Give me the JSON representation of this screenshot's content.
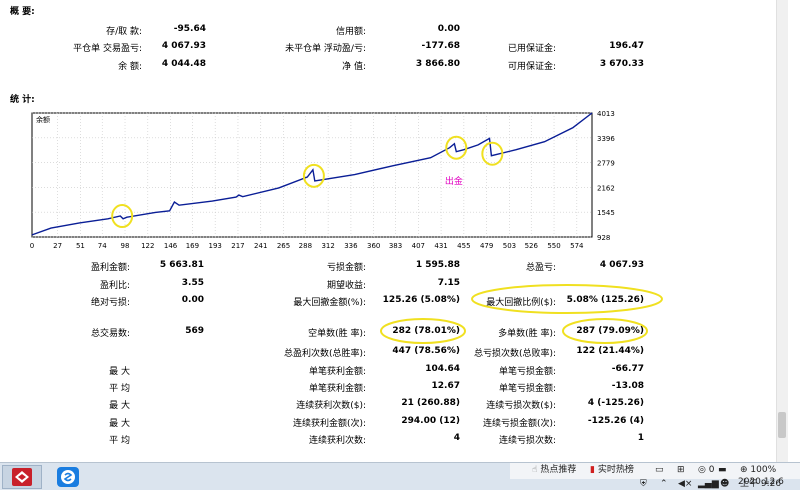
{
  "summary": {
    "title": "概 要:",
    "rows": [
      [
        {
          "label": "存/取 款:",
          "value": "-95.64"
        },
        {
          "label": "信用额:",
          "value": "0.00"
        },
        {
          "label": "",
          "value": ""
        }
      ],
      [
        {
          "label": "平仓单 交易盈亏:",
          "value": "4 067.93"
        },
        {
          "label": "未平仓单 浮动盈/亏:",
          "value": "-177.68"
        },
        {
          "label": "已用保证金:",
          "value": "196.47"
        }
      ],
      [
        {
          "label": "余 额:",
          "value": "4 044.48"
        },
        {
          "label": "净 值:",
          "value": "3 866.80"
        },
        {
          "label": "可用保证金:",
          "value": "3 670.33"
        }
      ]
    ]
  },
  "stats_title": "统 计:",
  "chart_data": {
    "type": "line",
    "series": [
      {
        "name": "余额",
        "color": "#0a1e96"
      }
    ],
    "title": "",
    "series_label": "余额",
    "xlabel": "",
    "ylabel": "",
    "xlim": [
      0,
      590
    ],
    "ylim": [
      928,
      4013
    ],
    "x_ticks": [
      "0",
      "27",
      "51",
      "74",
      "98",
      "122",
      "146",
      "169",
      "193",
      "217",
      "241",
      "265",
      "288",
      "312",
      "336",
      "360",
      "383",
      "407",
      "431",
      "455",
      "479",
      "503",
      "526",
      "550",
      "574"
    ],
    "y_ticks": [
      "4013",
      "3396",
      "2779",
      "2162",
      "1545",
      "928"
    ],
    "points": [
      [
        0,
        980
      ],
      [
        20,
        1150
      ],
      [
        50,
        1280
      ],
      [
        80,
        1380
      ],
      [
        93,
        1450
      ],
      [
        96,
        1380
      ],
      [
        100,
        1420
      ],
      [
        130,
        1540
      ],
      [
        145,
        1580
      ],
      [
        150,
        1800
      ],
      [
        155,
        1720
      ],
      [
        190,
        1820
      ],
      [
        215,
        1920
      ],
      [
        218,
        1970
      ],
      [
        222,
        1930
      ],
      [
        260,
        2150
      ],
      [
        290,
        2420
      ],
      [
        296,
        2600
      ],
      [
        298,
        2320
      ],
      [
        340,
        2480
      ],
      [
        380,
        2700
      ],
      [
        420,
        2900
      ],
      [
        440,
        3150
      ],
      [
        445,
        3250
      ],
      [
        447,
        3050
      ],
      [
        455,
        3100
      ],
      [
        470,
        3220
      ],
      [
        482,
        3380
      ],
      [
        484,
        2950
      ],
      [
        510,
        3100
      ],
      [
        540,
        3300
      ],
      [
        570,
        3650
      ],
      [
        590,
        4013
      ]
    ],
    "annotation": {
      "text": "出金",
      "color": "#e000c0",
      "x": 435,
      "y": 2250
    },
    "highlights": [
      {
        "x": 95,
        "y": 1450
      },
      {
        "x": 297,
        "y": 2450
      },
      {
        "x": 447,
        "y": 3150
      },
      {
        "x": 485,
        "y": 3000
      }
    ],
    "grid": true
  },
  "stats": {
    "col1": [
      {
        "label": "盈利金额:",
        "value": "5 663.81"
      },
      {
        "label": "盈利比:",
        "value": "3.55"
      },
      {
        "label": "绝对亏损:",
        "value": "0.00"
      },
      {
        "label": "总交易数:",
        "value": "569"
      },
      {
        "label": "最 大",
        "value": ""
      },
      {
        "label": "平 均",
        "value": ""
      },
      {
        "label": "最 大",
        "value": ""
      },
      {
        "label": "最 大",
        "value": ""
      },
      {
        "label": "平 均",
        "value": ""
      }
    ],
    "col2": [
      {
        "label": "亏损金额:",
        "value": "1 595.88"
      },
      {
        "label": "期望收益:",
        "value": "7.15"
      },
      {
        "label": "最大回撤金额(%):",
        "value": "125.26 (5.08%)"
      },
      {
        "label": "空单数(胜 率):",
        "value": "282 (78.01%)"
      },
      {
        "label": "总盈利次数(总胜率):",
        "value": "447 (78.56%)"
      },
      {
        "label": "单笔获利金额:",
        "value": "104.64"
      },
      {
        "label": "单笔获利金额:",
        "value": "12.67"
      },
      {
        "label": "连续获利次数($):",
        "value": "21 (260.88)"
      },
      {
        "label": "连续获利金额(次):",
        "value": "294.00 (12)"
      },
      {
        "label": "连续获利次数:",
        "value": "4"
      }
    ],
    "col3": [
      {
        "label": "总盈亏:",
        "value": "4 067.93"
      },
      {
        "label": "最大回撤比例($):",
        "value": "5.08% (125.26)"
      },
      {
        "label": "多单数(胜 率):",
        "value": "287 (79.09%)"
      },
      {
        "label": "总亏损次数(总败率):",
        "value": "122 (21.44%)"
      },
      {
        "label": "单笔亏损金额:",
        "value": "-66.77"
      },
      {
        "label": "单笔亏损金额:",
        "value": "-13.08"
      },
      {
        "label": "连续亏损次数($):",
        "value": "4 (-125.26)"
      },
      {
        "label": "连续亏损金额(次):",
        "value": "-125.26 (4)"
      },
      {
        "label": "连续亏损次数:",
        "value": "1"
      }
    ]
  },
  "taskbar": {
    "tray_items": {
      "hot": "热点推荐",
      "live": "实时热榜",
      "zoom": "100%",
      "battery": "0"
    },
    "time": "上午 9:26",
    "date": "2020.12.6"
  },
  "colors": {
    "line": "#0a1e96",
    "highlight": "#f0e020",
    "grid": "#c8c8c8"
  }
}
